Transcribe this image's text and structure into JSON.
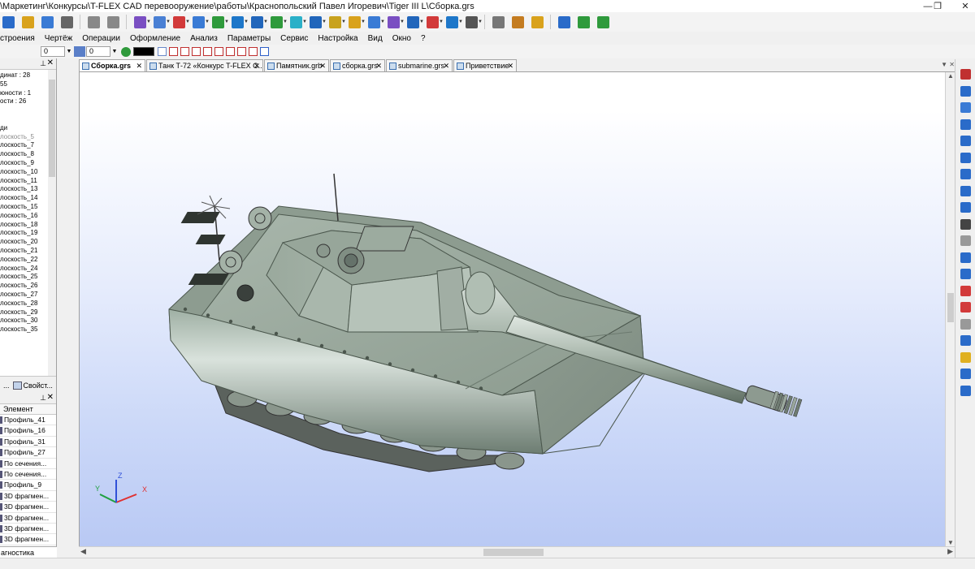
{
  "title_bar": {
    "title": "\\Маркетинг\\Конкурсы\\T-FLEX CAD перевооружение\\работы\\Краснопольский Павел Игоревич\\Tiger III L\\Сборка.grs",
    "minimize": "—",
    "restore": "❐",
    "close": "✕"
  },
  "toolbar_main": {
    "icons": [
      "new-document",
      "open-folder",
      "save",
      "print",
      "undo",
      "redo",
      "sketch",
      "workplane",
      "coordinate-system",
      "3d-node",
      "3d-profile",
      "extrusion",
      "rotation",
      "loft",
      "sweep",
      "boolean",
      "fillet",
      "chamfer",
      "shell",
      "thicken",
      "array",
      "mirror",
      "cut",
      "measure",
      "dimension",
      "document-props",
      "help",
      "link",
      "magic-wand",
      "3d-view"
    ],
    "colors": [
      "#2a6bc9",
      "#d9a21c",
      "#3a7bd5",
      "#666666",
      "#888888",
      "#888888",
      "#7a4fc2",
      "#4a80d4",
      "#d23a3a",
      "#3a7bd5",
      "#2f9a3c",
      "#1e77c9",
      "#2266bb",
      "#2f9a3c",
      "#2bb0c8",
      "#2266bb",
      "#c8a21e",
      "#d9a21c",
      "#3a7bd5",
      "#7a4fc2",
      "#2266bb",
      "#d23a3a",
      "#1e77c9",
      "#555555",
      "#777777",
      "#c47c20",
      "#d9a21c",
      "#2a6bc9",
      "#2f9a3c",
      "#2f9a3c"
    ]
  },
  "menu": [
    "Построения",
    "Чертёж",
    "Операции",
    "Оформление",
    "Анализ",
    "Параметры",
    "Сервис",
    "Настройка",
    "Вид",
    "Окно",
    "?"
  ],
  "menu_display": [
    "строения",
    "Чертёж",
    "Операции",
    "Оформление",
    "Анализ",
    "Параметры",
    "Сервис",
    "Настройка",
    "Вид",
    "Окно",
    "?"
  ],
  "toolbar_props": {
    "layer_value": "0",
    "level_value": "0",
    "color_value": "#000000"
  },
  "left_panel": {
    "tree": [
      {
        "text": "динат : 28",
        "grey": false
      },
      {
        "text": "55",
        "grey": false
      },
      {
        "text": "юности : 1",
        "grey": false
      },
      {
        "text": "ости : 26",
        "grey": false
      },
      {
        "text": "",
        "grey": false
      },
      {
        "text": "",
        "grey": false
      },
      {
        "text": "ди",
        "grey": false
      },
      {
        "text": "лоскость_5",
        "grey": true
      },
      {
        "text": "лоскость_7",
        "grey": false
      },
      {
        "text": "лоскость_8",
        "grey": false
      },
      {
        "text": "лоскость_9",
        "grey": false
      },
      {
        "text": "лоскость_10",
        "grey": false
      },
      {
        "text": "лоскость_11",
        "grey": false
      },
      {
        "text": "лоскость_13",
        "grey": false
      },
      {
        "text": "лоскость_14",
        "grey": false
      },
      {
        "text": "лоскость_15",
        "grey": false
      },
      {
        "text": "лоскость_16",
        "grey": false
      },
      {
        "text": "лоскость_18",
        "grey": false
      },
      {
        "text": "лоскость_19",
        "grey": false
      },
      {
        "text": "лоскость_20",
        "grey": false
      },
      {
        "text": "лоскость_21",
        "grey": false
      },
      {
        "text": "лоскость_22",
        "grey": false
      },
      {
        "text": "лоскость_24",
        "grey": false
      },
      {
        "text": "лоскость_25",
        "grey": false
      },
      {
        "text": "лоскость_26",
        "grey": false
      },
      {
        "text": "лоскость_27",
        "grey": false
      },
      {
        "text": "лоскость_28",
        "grey": false
      },
      {
        "text": "лоскость_29",
        "grey": false
      },
      {
        "text": "лоскость_30",
        "grey": false
      },
      {
        "text": "лоскость_35",
        "grey": false
      }
    ],
    "footer_ellipsis": "...",
    "footer_props": "Свойст..."
  },
  "element_panel": {
    "column_header": "Элемент",
    "rows": [
      "Профиль_41",
      "Профиль_16",
      "Профиль_31",
      "Профиль_27",
      "По сечения...",
      "По сечения...",
      "Профиль_9",
      "3D фрагмен...",
      "3D фрагмен...",
      "3D фрагмен...",
      "3D фрагмен...",
      "3D фрагмен..."
    ],
    "bottom_tab": "агностика"
  },
  "doc_tabs": [
    {
      "label": "Сборка.grs",
      "active": true
    },
    {
      "label": "Танк Т-72 «Конкурс T-FLEX С...",
      "active": false
    },
    {
      "label": "Памятник.grb",
      "active": false
    },
    {
      "label": "сборка.grs",
      "active": false
    },
    {
      "label": "submarine.grs",
      "active": false
    },
    {
      "label": "Приветствие",
      "active": false
    }
  ],
  "tab_close": "✕",
  "axis_labels": {
    "x": "X",
    "y": "Y",
    "z": "Z"
  },
  "axis_colors": {
    "x": "#e03030",
    "y": "#20a040",
    "z": "#3050d8"
  },
  "right_toolbar": {
    "icons": [
      "magnet-icon",
      "snap-icon",
      "lock-icon",
      "zoom-window",
      "fit-all",
      "frame",
      "zoom-in",
      "zoom-out",
      "zoom-prev",
      "glasses",
      "copy",
      "grid",
      "cube",
      "check-mark",
      "check-mark2",
      "section",
      "cube-view",
      "cube-yellow",
      "shading",
      "frame-view"
    ],
    "colors": [
      "#c03030",
      "#2a6bc9",
      "#3a7bd5",
      "#2a6bc9",
      "#2a6bc9",
      "#2a6bc9",
      "#2a6bc9",
      "#2a6bc9",
      "#2a6bc9",
      "#444444",
      "#999999",
      "#2a6bc9",
      "#2a6bc9",
      "#d23a3a",
      "#d23a3a",
      "#999999",
      "#2a6bc9",
      "#e0b020",
      "#2a6bc9",
      "#2a6bc9"
    ]
  }
}
